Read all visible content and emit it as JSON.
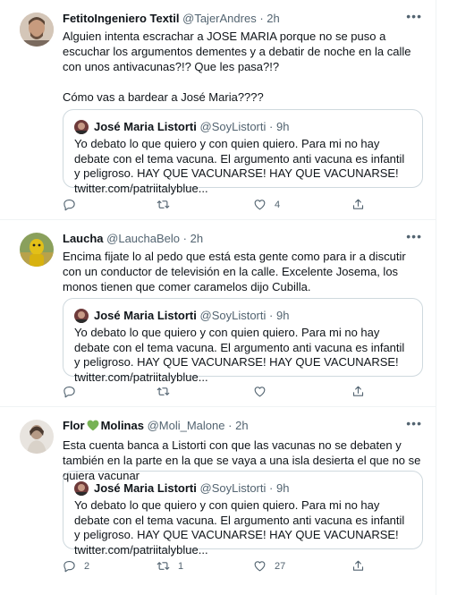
{
  "quoted": {
    "name": "José Maria Listorti",
    "handle": "@SoyListorti",
    "time": "9h",
    "text": "Yo debato lo que quiero y con quien quiero. Para mi no hay debate con el tema vacuna. El argumento anti vacuna es infantil y peligroso. HAY QUE VACUNARSE! HAY QUE VACUNARSE! twitter.com/patriitalyblue..."
  },
  "tweets": [
    {
      "name": "FetitoIngeniero Textil",
      "handle": "@TajerAndres",
      "time": "2h",
      "text": "Alguien intenta escrachar a JOSE MARIA porque no se puso a escuchar los argumentos dementes y a debatir de noche en la calle con unos antivacunas?!? Que les pasa?!?\n\nCómo vas a bardear a José Maria????",
      "replies": "",
      "retweets": "",
      "likes": "4"
    },
    {
      "name": "Laucha",
      "handle": "@LauchaBelo",
      "time": "2h",
      "text": "Encima fijate lo al pedo que está esta gente como para ir a discutir con un conductor de televisión en la calle. Excelente Josema, los monos tienen que comer caramelos dijo Cubilla.",
      "replies": "",
      "retweets": "",
      "likes": ""
    },
    {
      "name_first": "Flor",
      "name_emoji": "green-heart",
      "name_last": "Molinas",
      "handle": "@Moli_Malone",
      "time": "2h",
      "text": "Esta cuenta banca a Listorti con que las vacunas no se debaten y también en la parte en la que se vaya a una isla desierta el que no se quiera vacunar",
      "replies": "2",
      "retweets": "1",
      "likes": "27"
    }
  ],
  "separator": "·",
  "more_label": "•••",
  "colors": {
    "text": "#0f1419",
    "muted": "#536471",
    "border": "#cfd9de",
    "emoji_heart": "#77b255"
  }
}
